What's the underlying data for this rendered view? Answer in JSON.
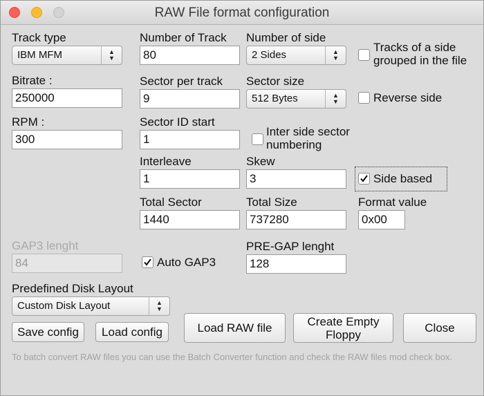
{
  "window": {
    "title": "RAW File format configuration"
  },
  "track_type": {
    "label": "Track type",
    "value": "IBM MFM"
  },
  "bitrate": {
    "label": "Bitrate :",
    "value": "250000"
  },
  "rpm": {
    "label": "RPM :",
    "value": "300"
  },
  "number_of_track": {
    "label": "Number of Track",
    "value": "80"
  },
  "sector_per_track": {
    "label": "Sector per track",
    "value": "9"
  },
  "sector_id_start": {
    "label": "Sector ID start",
    "value": "1"
  },
  "interleave": {
    "label": "Interleave",
    "value": "1"
  },
  "total_sector": {
    "label": "Total Sector",
    "value": "1440"
  },
  "number_of_side": {
    "label": "Number of side",
    "value": "2 Sides"
  },
  "sector_size": {
    "label": "Sector size",
    "value": "512 Bytes"
  },
  "skew": {
    "label": "Skew",
    "value": "3"
  },
  "total_size": {
    "label": "Total Size",
    "value": "737280"
  },
  "format_value": {
    "label": "Format value",
    "value": "0x00"
  },
  "checkboxes": {
    "tracks_grouped": {
      "label_line1": "Tracks of a side",
      "label_line2": "grouped in the file",
      "checked": false
    },
    "reverse_side": {
      "label": "Reverse side",
      "checked": false
    },
    "inter_side_numbering": {
      "label_line1": "Inter side sector",
      "label_line2": "numbering",
      "checked": false
    },
    "side_based": {
      "label": "Side based",
      "checked": true
    },
    "auto_gap3": {
      "label": "Auto GAP3",
      "checked": true
    }
  },
  "gap3_length": {
    "label": "GAP3 lenght",
    "value": "84",
    "enabled": false
  },
  "pre_gap_length": {
    "label": "PRE-GAP lenght",
    "value": "128"
  },
  "predefined_layout": {
    "label": "Predefined Disk Layout",
    "value": "Custom Disk Layout"
  },
  "buttons": {
    "save_config": "Save config",
    "load_config": "Load config",
    "load_raw_file": "Load RAW file",
    "create_empty_floppy_line1": "Create Empty",
    "create_empty_floppy_line2": "Floppy",
    "close": "Close"
  },
  "hint": "To batch convert RAW files you can use the Batch Converter function and check the RAW files mod check box.",
  "colors": {
    "close_light": "#fc5f57",
    "minimize_light": "#fdbc2e",
    "zoom_light": "#d3d3d3",
    "background": "#dcdcdc"
  },
  "icons": {
    "select_arrows": "up-down-chevron-icon",
    "checkmark": "checkmark-icon"
  }
}
